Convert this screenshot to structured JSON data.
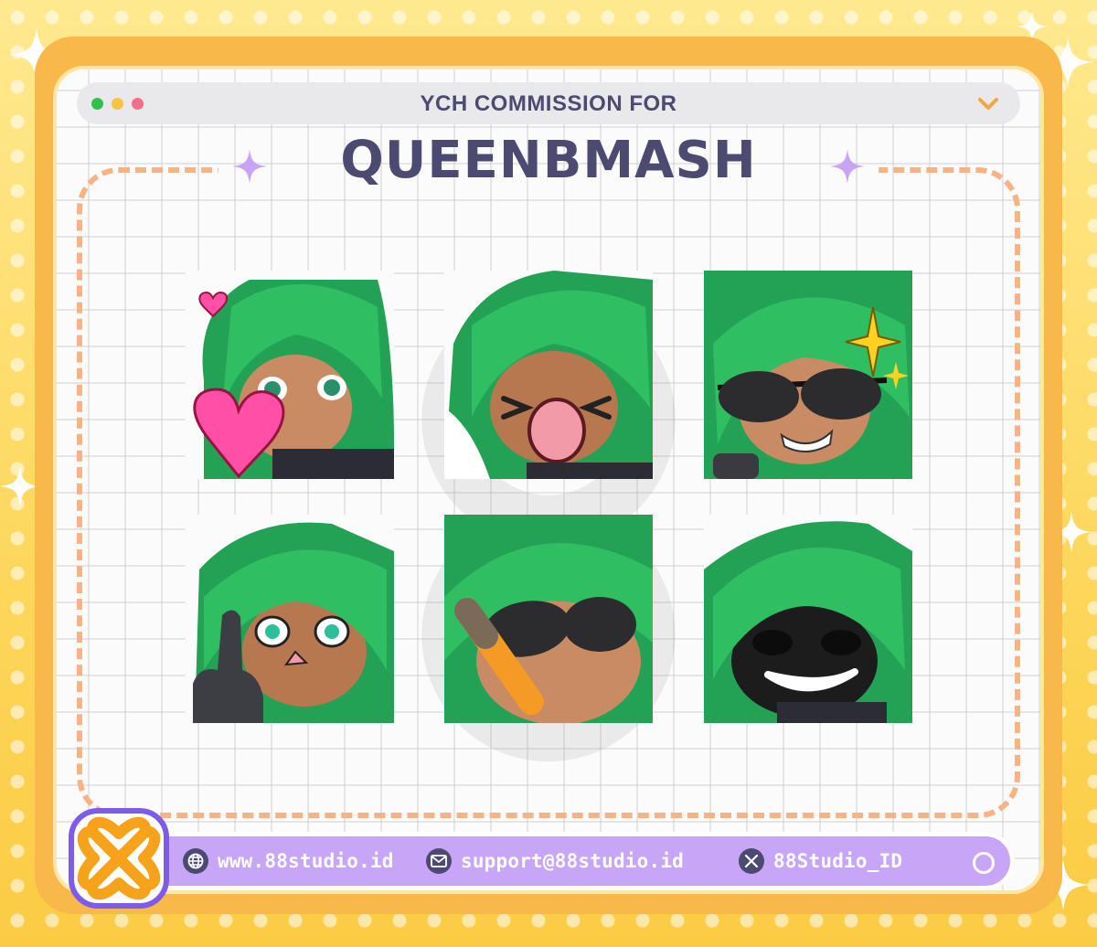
{
  "window": {
    "subtitle": "YCH COMMISSION FOR",
    "title": "QUEENBMASH",
    "traffic_lights": [
      "#2fc24b",
      "#f6c442",
      "#f0708c"
    ]
  },
  "emotes": [
    {
      "name": "heart-emote",
      "prop": "heart"
    },
    {
      "name": "blush-tongue-emote",
      "prop": "tongue"
    },
    {
      "name": "sunglasses-sparkle-emote",
      "prop": "sunglasses"
    },
    {
      "name": "middle-finger-emote",
      "prop": "finger"
    },
    {
      "name": "cigar-sunglasses-emote",
      "prop": "cigar"
    },
    {
      "name": "evil-grin-emote",
      "prop": "grin"
    }
  ],
  "footer": {
    "website": "www.88studio.id",
    "email": "support@88studio.id",
    "twitter": "88Studio_ID"
  },
  "colors": {
    "accent": "#4d4a72",
    "footer_bg": "#c7a6f7",
    "logo_ring": "#7d5ce8",
    "logo_fill": "#f6a21a",
    "hair": "#2aa958"
  }
}
